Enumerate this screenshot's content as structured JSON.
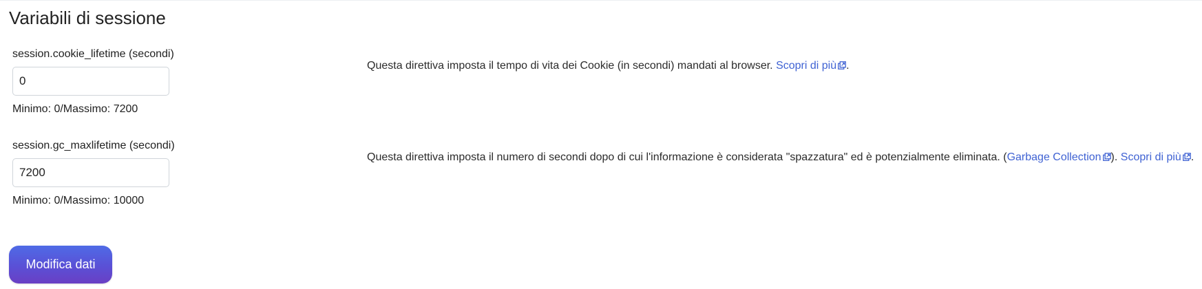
{
  "section": {
    "title": "Variabili di sessione"
  },
  "settings": [
    {
      "label": "session.cookie_lifetime (secondi)",
      "value": "0",
      "range": "Minimo: 0/Massimo: 7200",
      "description_before": "Questa direttiva imposta il tempo di vita dei Cookie (in secondi) mandati al browser. ",
      "learn_more": "Scopri di più",
      "description_after": "."
    },
    {
      "label": "session.gc_maxlifetime (secondi)",
      "value": "7200",
      "range": "Minimo: 0/Massimo: 10000",
      "description_before": "Questa direttiva imposta il numero di secondi dopo di cui l'informazione è considerata \"spazzatura\" ed è potenzialmente eliminata. (",
      "gc_link": "Garbage Collection",
      "description_middle": "). ",
      "learn_more": "Scopri di più",
      "description_after": "."
    }
  ],
  "actions": {
    "submit_label": "Modifica dati"
  },
  "icons": {
    "external_link": "external-link-icon"
  },
  "colors": {
    "link": "#3f62d3",
    "button_gradient_start": "#4f6be6",
    "button_gradient_end": "#6a3fc4"
  }
}
